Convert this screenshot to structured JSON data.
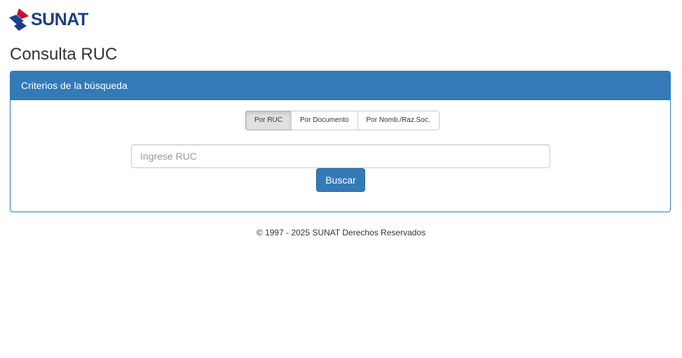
{
  "header": {
    "logo_text": "SUNAT",
    "logo_colors": {
      "red": "#c8102e",
      "blue": "#1d3f8b"
    }
  },
  "page": {
    "title": "Consulta RUC"
  },
  "panel": {
    "heading": "Criterios de la búsqueda",
    "accent_color": "#337ab7",
    "tabs": [
      {
        "label": "Por RUC",
        "active": true
      },
      {
        "label": "Por Documento",
        "active": false
      },
      {
        "label": "Por Nomb./Raz.Soc.",
        "active": false
      }
    ],
    "input": {
      "placeholder": "Ingrese RUC",
      "value": ""
    },
    "search_button": "Buscar"
  },
  "footer": {
    "text": "© 1997 - 2025 SUNAT Derechos Reservados"
  }
}
